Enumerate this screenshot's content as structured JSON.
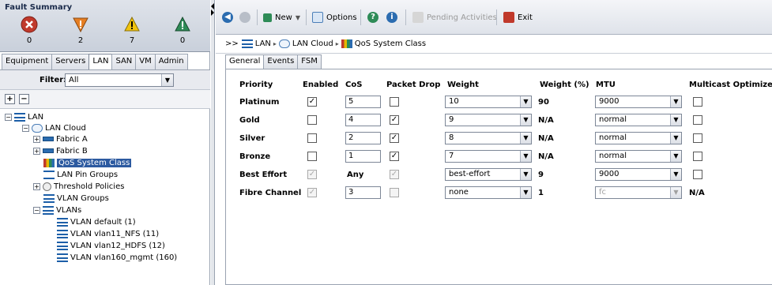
{
  "fault_summary": {
    "title": "Fault Summary",
    "items": [
      {
        "icon": "critical-fault-icon",
        "count": "0",
        "color": "#c0392b"
      },
      {
        "icon": "major-fault-icon",
        "count": "2",
        "color": "#e67e22"
      },
      {
        "icon": "minor-fault-icon",
        "count": "7",
        "color": "#f1c40f"
      },
      {
        "icon": "warning-fault-icon",
        "count": "0",
        "color": "#2e8b57"
      }
    ]
  },
  "nav_tabs": [
    "Equipment",
    "Servers",
    "LAN",
    "SAN",
    "VM",
    "Admin"
  ],
  "filter": {
    "label": "Filter:",
    "value": "All"
  },
  "tree": {
    "lan": "LAN",
    "lan_cloud": "LAN Cloud",
    "fabric_a": "Fabric A",
    "fabric_b": "Fabric B",
    "qos_system_class": "QoS System Class",
    "lan_pin_groups": "LAN Pin Groups",
    "threshold_policies": "Threshold Policies",
    "vlan_groups": "VLAN Groups",
    "vlans": "VLANs",
    "vlan_default": "VLAN default (1)",
    "vlan_nfs": "VLAN vlan11_NFS (11)",
    "vlan_hdfs": "VLAN vlan12_HDFS (12)",
    "vlan_mgmt": "VLAN vlan160_mgmt (160)"
  },
  "toolbar": {
    "new_label": "New",
    "options_label": "Options",
    "pending_label": "Pending Activities",
    "exit_label": "Exit"
  },
  "breadcrumb": {
    "prefix": ">>",
    "items": [
      "LAN",
      "LAN Cloud",
      "QoS System Class"
    ]
  },
  "panel_tabs": [
    "General",
    "Events",
    "FSM"
  ],
  "columns": {
    "priority": "Priority",
    "enabled": "Enabled",
    "cos": "CoS",
    "packet_drop": "Packet Drop",
    "weight": "Weight",
    "weight_pct": "Weight (%)",
    "mtu": "MTU",
    "multicast": "Multicast Optimized"
  },
  "rows": [
    {
      "priority": "Platinum",
      "enabled": "✓",
      "cos": "5",
      "packet_drop": "",
      "weight": "10",
      "weight_pct": "90",
      "mtu": "9000",
      "multicast": ""
    },
    {
      "priority": "Gold",
      "enabled": "",
      "cos": "4",
      "packet_drop": "✓",
      "weight": "9",
      "weight_pct": "N/A",
      "mtu": "normal",
      "multicast": ""
    },
    {
      "priority": "Silver",
      "enabled": "",
      "cos": "2",
      "packet_drop": "✓",
      "weight": "8",
      "weight_pct": "N/A",
      "mtu": "normal",
      "multicast": ""
    },
    {
      "priority": "Bronze",
      "enabled": "",
      "cos": "1",
      "packet_drop": "✓",
      "weight": "7",
      "weight_pct": "N/A",
      "mtu": "normal",
      "multicast": ""
    },
    {
      "priority": "Best Effort",
      "enabled": "✓",
      "cos": "Any",
      "packet_drop": "✓",
      "weight": "best-effort",
      "weight_pct": "9",
      "mtu": "9000",
      "multicast": ""
    },
    {
      "priority": "Fibre Channel",
      "enabled": "✓",
      "cos": "3",
      "packet_drop": "",
      "weight": "none",
      "weight_pct": "1",
      "mtu": "fc",
      "multicast": "N/A"
    }
  ]
}
